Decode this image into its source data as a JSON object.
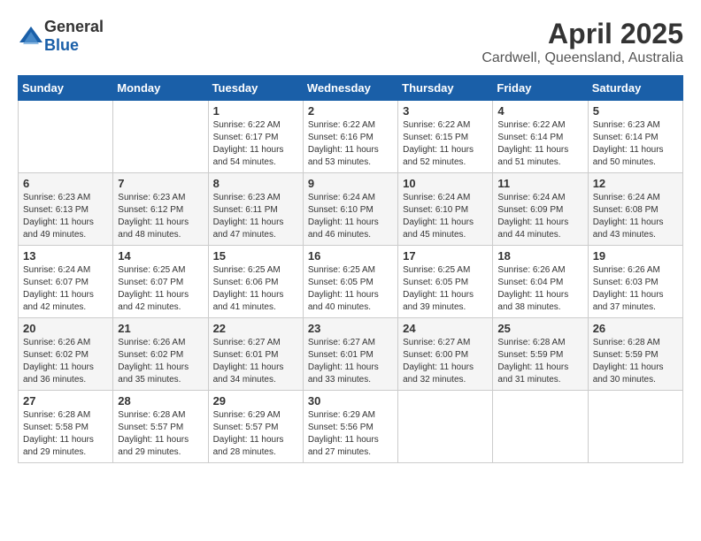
{
  "logo": {
    "general": "General",
    "blue": "Blue"
  },
  "title": "April 2025",
  "location": "Cardwell, Queensland, Australia",
  "days_of_week": [
    "Sunday",
    "Monday",
    "Tuesday",
    "Wednesday",
    "Thursday",
    "Friday",
    "Saturday"
  ],
  "weeks": [
    [
      {
        "day": "",
        "sunrise": "",
        "sunset": "",
        "daylight": ""
      },
      {
        "day": "",
        "sunrise": "",
        "sunset": "",
        "daylight": ""
      },
      {
        "day": "1",
        "sunrise": "Sunrise: 6:22 AM",
        "sunset": "Sunset: 6:17 PM",
        "daylight": "Daylight: 11 hours and 54 minutes."
      },
      {
        "day": "2",
        "sunrise": "Sunrise: 6:22 AM",
        "sunset": "Sunset: 6:16 PM",
        "daylight": "Daylight: 11 hours and 53 minutes."
      },
      {
        "day": "3",
        "sunrise": "Sunrise: 6:22 AM",
        "sunset": "Sunset: 6:15 PM",
        "daylight": "Daylight: 11 hours and 52 minutes."
      },
      {
        "day": "4",
        "sunrise": "Sunrise: 6:22 AM",
        "sunset": "Sunset: 6:14 PM",
        "daylight": "Daylight: 11 hours and 51 minutes."
      },
      {
        "day": "5",
        "sunrise": "Sunrise: 6:23 AM",
        "sunset": "Sunset: 6:14 PM",
        "daylight": "Daylight: 11 hours and 50 minutes."
      }
    ],
    [
      {
        "day": "6",
        "sunrise": "Sunrise: 6:23 AM",
        "sunset": "Sunset: 6:13 PM",
        "daylight": "Daylight: 11 hours and 49 minutes."
      },
      {
        "day": "7",
        "sunrise": "Sunrise: 6:23 AM",
        "sunset": "Sunset: 6:12 PM",
        "daylight": "Daylight: 11 hours and 48 minutes."
      },
      {
        "day": "8",
        "sunrise": "Sunrise: 6:23 AM",
        "sunset": "Sunset: 6:11 PM",
        "daylight": "Daylight: 11 hours and 47 minutes."
      },
      {
        "day": "9",
        "sunrise": "Sunrise: 6:24 AM",
        "sunset": "Sunset: 6:10 PM",
        "daylight": "Daylight: 11 hours and 46 minutes."
      },
      {
        "day": "10",
        "sunrise": "Sunrise: 6:24 AM",
        "sunset": "Sunset: 6:10 PM",
        "daylight": "Daylight: 11 hours and 45 minutes."
      },
      {
        "day": "11",
        "sunrise": "Sunrise: 6:24 AM",
        "sunset": "Sunset: 6:09 PM",
        "daylight": "Daylight: 11 hours and 44 minutes."
      },
      {
        "day": "12",
        "sunrise": "Sunrise: 6:24 AM",
        "sunset": "Sunset: 6:08 PM",
        "daylight": "Daylight: 11 hours and 43 minutes."
      }
    ],
    [
      {
        "day": "13",
        "sunrise": "Sunrise: 6:24 AM",
        "sunset": "Sunset: 6:07 PM",
        "daylight": "Daylight: 11 hours and 42 minutes."
      },
      {
        "day": "14",
        "sunrise": "Sunrise: 6:25 AM",
        "sunset": "Sunset: 6:07 PM",
        "daylight": "Daylight: 11 hours and 42 minutes."
      },
      {
        "day": "15",
        "sunrise": "Sunrise: 6:25 AM",
        "sunset": "Sunset: 6:06 PM",
        "daylight": "Daylight: 11 hours and 41 minutes."
      },
      {
        "day": "16",
        "sunrise": "Sunrise: 6:25 AM",
        "sunset": "Sunset: 6:05 PM",
        "daylight": "Daylight: 11 hours and 40 minutes."
      },
      {
        "day": "17",
        "sunrise": "Sunrise: 6:25 AM",
        "sunset": "Sunset: 6:05 PM",
        "daylight": "Daylight: 11 hours and 39 minutes."
      },
      {
        "day": "18",
        "sunrise": "Sunrise: 6:26 AM",
        "sunset": "Sunset: 6:04 PM",
        "daylight": "Daylight: 11 hours and 38 minutes."
      },
      {
        "day": "19",
        "sunrise": "Sunrise: 6:26 AM",
        "sunset": "Sunset: 6:03 PM",
        "daylight": "Daylight: 11 hours and 37 minutes."
      }
    ],
    [
      {
        "day": "20",
        "sunrise": "Sunrise: 6:26 AM",
        "sunset": "Sunset: 6:02 PM",
        "daylight": "Daylight: 11 hours and 36 minutes."
      },
      {
        "day": "21",
        "sunrise": "Sunrise: 6:26 AM",
        "sunset": "Sunset: 6:02 PM",
        "daylight": "Daylight: 11 hours and 35 minutes."
      },
      {
        "day": "22",
        "sunrise": "Sunrise: 6:27 AM",
        "sunset": "Sunset: 6:01 PM",
        "daylight": "Daylight: 11 hours and 34 minutes."
      },
      {
        "day": "23",
        "sunrise": "Sunrise: 6:27 AM",
        "sunset": "Sunset: 6:01 PM",
        "daylight": "Daylight: 11 hours and 33 minutes."
      },
      {
        "day": "24",
        "sunrise": "Sunrise: 6:27 AM",
        "sunset": "Sunset: 6:00 PM",
        "daylight": "Daylight: 11 hours and 32 minutes."
      },
      {
        "day": "25",
        "sunrise": "Sunrise: 6:28 AM",
        "sunset": "Sunset: 5:59 PM",
        "daylight": "Daylight: 11 hours and 31 minutes."
      },
      {
        "day": "26",
        "sunrise": "Sunrise: 6:28 AM",
        "sunset": "Sunset: 5:59 PM",
        "daylight": "Daylight: 11 hours and 30 minutes."
      }
    ],
    [
      {
        "day": "27",
        "sunrise": "Sunrise: 6:28 AM",
        "sunset": "Sunset: 5:58 PM",
        "daylight": "Daylight: 11 hours and 29 minutes."
      },
      {
        "day": "28",
        "sunrise": "Sunrise: 6:28 AM",
        "sunset": "Sunset: 5:57 PM",
        "daylight": "Daylight: 11 hours and 29 minutes."
      },
      {
        "day": "29",
        "sunrise": "Sunrise: 6:29 AM",
        "sunset": "Sunset: 5:57 PM",
        "daylight": "Daylight: 11 hours and 28 minutes."
      },
      {
        "day": "30",
        "sunrise": "Sunrise: 6:29 AM",
        "sunset": "Sunset: 5:56 PM",
        "daylight": "Daylight: 11 hours and 27 minutes."
      },
      {
        "day": "",
        "sunrise": "",
        "sunset": "",
        "daylight": ""
      },
      {
        "day": "",
        "sunrise": "",
        "sunset": "",
        "daylight": ""
      },
      {
        "day": "",
        "sunrise": "",
        "sunset": "",
        "daylight": ""
      }
    ]
  ]
}
